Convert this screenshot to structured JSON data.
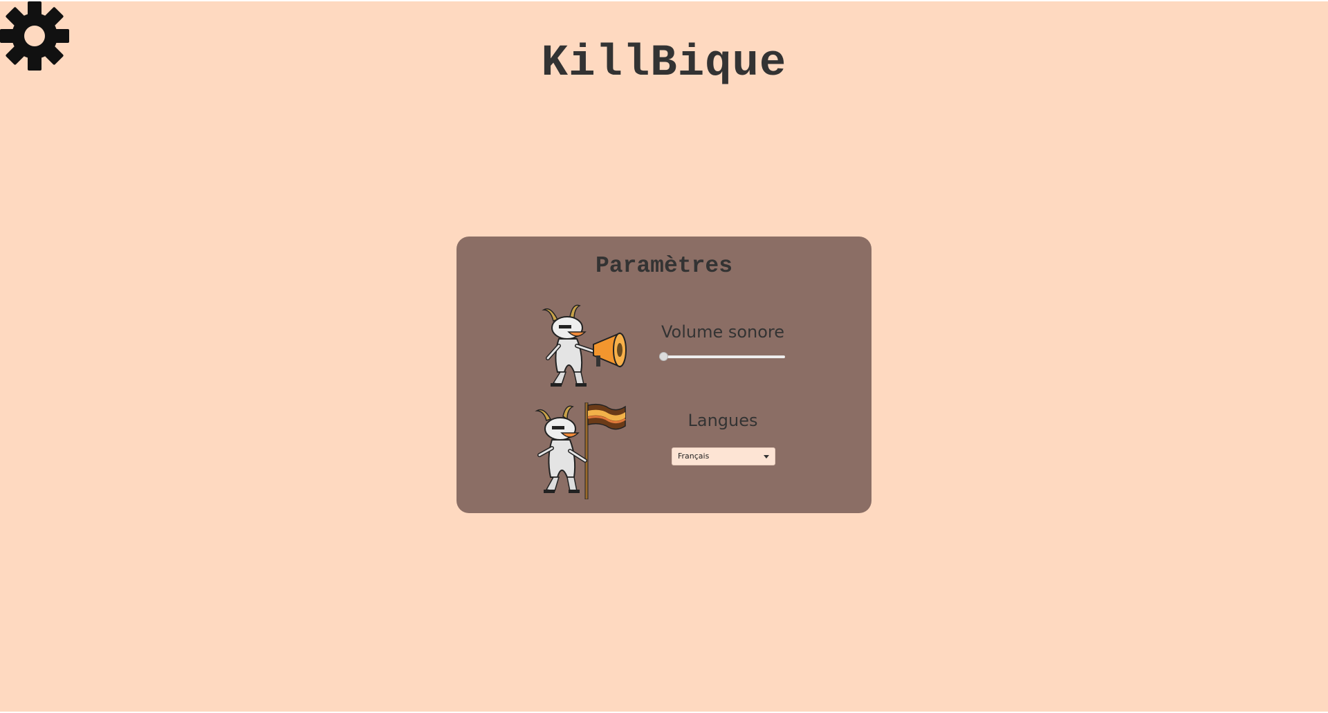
{
  "app": {
    "title": "KillBique"
  },
  "header": {
    "settings_icon": "gear-icon"
  },
  "settings_panel": {
    "title": "Paramètres",
    "volume": {
      "label": "Volume sonore",
      "value": 0,
      "icon": "goat-megaphone-illustration"
    },
    "language": {
      "label": "Langues",
      "selected": "Français",
      "icon": "goat-flag-illustration"
    }
  },
  "colors": {
    "background": "#fed9c0",
    "panel": "#8b6e65",
    "text": "#333333",
    "select_bg": "#fde4d4"
  }
}
